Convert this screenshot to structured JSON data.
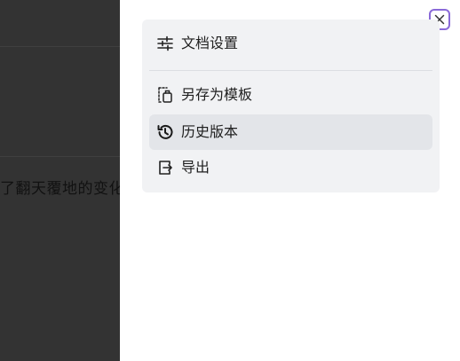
{
  "background_doc": {
    "text_fragment": "了翻天覆地的变化"
  },
  "panel": {
    "close_icon": "close-icon",
    "menu": {
      "items": [
        {
          "label": "文档设置",
          "icon": "sliders-icon"
        },
        {
          "label": "另存为模板",
          "icon": "template-icon"
        },
        {
          "label": "历史版本",
          "icon": "history-icon",
          "active": true
        },
        {
          "label": "导出",
          "icon": "export-icon"
        }
      ]
    }
  },
  "colors": {
    "accent": "#8a6ad8",
    "card_bg": "#f1f2f4",
    "active_bg": "#e3e5e9",
    "overlay": "#333333"
  }
}
